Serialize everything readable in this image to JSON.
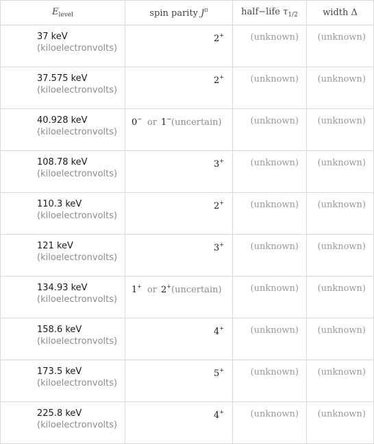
{
  "header": {
    "energy": {
      "symbol": "E",
      "subscript": "level"
    },
    "spin": {
      "label": "spin parity",
      "symbol": "J",
      "superscript": "π"
    },
    "halflife": {
      "label": "half−life",
      "symbol": "τ",
      "subscript": "1/2"
    },
    "width": {
      "label": "width",
      "symbol": "Δ"
    }
  },
  "unit_label": "(kiloelectronvolts)",
  "or_label": "or",
  "uncertain_label": "(uncertain)",
  "rows": [
    {
      "energy": "37 keV",
      "spin": [
        {
          "j": "2",
          "p": "+"
        }
      ],
      "uncertain": false,
      "halflife": "(unknown)",
      "width": "(unknown)"
    },
    {
      "energy": "37.575 keV",
      "spin": [
        {
          "j": "2",
          "p": "+"
        }
      ],
      "uncertain": false,
      "halflife": "(unknown)",
      "width": "(unknown)"
    },
    {
      "energy": "40.928 keV",
      "spin": [
        {
          "j": "0",
          "p": "−"
        },
        {
          "j": "1",
          "p": "−"
        }
      ],
      "uncertain": true,
      "halflife": "(unknown)",
      "width": "(unknown)"
    },
    {
      "energy": "108.78 keV",
      "spin": [
        {
          "j": "3",
          "p": "+"
        }
      ],
      "uncertain": false,
      "halflife": "(unknown)",
      "width": "(unknown)"
    },
    {
      "energy": "110.3 keV",
      "spin": [
        {
          "j": "2",
          "p": "+"
        }
      ],
      "uncertain": false,
      "halflife": "(unknown)",
      "width": "(unknown)"
    },
    {
      "energy": "121 keV",
      "spin": [
        {
          "j": "3",
          "p": "+"
        }
      ],
      "uncertain": false,
      "halflife": "(unknown)",
      "width": "(unknown)"
    },
    {
      "energy": "134.93 keV",
      "spin": [
        {
          "j": "1",
          "p": "+"
        },
        {
          "j": "2",
          "p": "+"
        }
      ],
      "uncertain": true,
      "halflife": "(unknown)",
      "width": "(unknown)"
    },
    {
      "energy": "158.6 keV",
      "spin": [
        {
          "j": "4",
          "p": "+"
        }
      ],
      "uncertain": false,
      "halflife": "(unknown)",
      "width": "(unknown)"
    },
    {
      "energy": "173.5 keV",
      "spin": [
        {
          "j": "5",
          "p": "+"
        }
      ],
      "uncertain": false,
      "halflife": "(unknown)",
      "width": "(unknown)"
    },
    {
      "energy": "225.8 keV",
      "spin": [
        {
          "j": "4",
          "p": "+"
        }
      ],
      "uncertain": false,
      "halflife": "(unknown)",
      "width": "(unknown)"
    }
  ]
}
